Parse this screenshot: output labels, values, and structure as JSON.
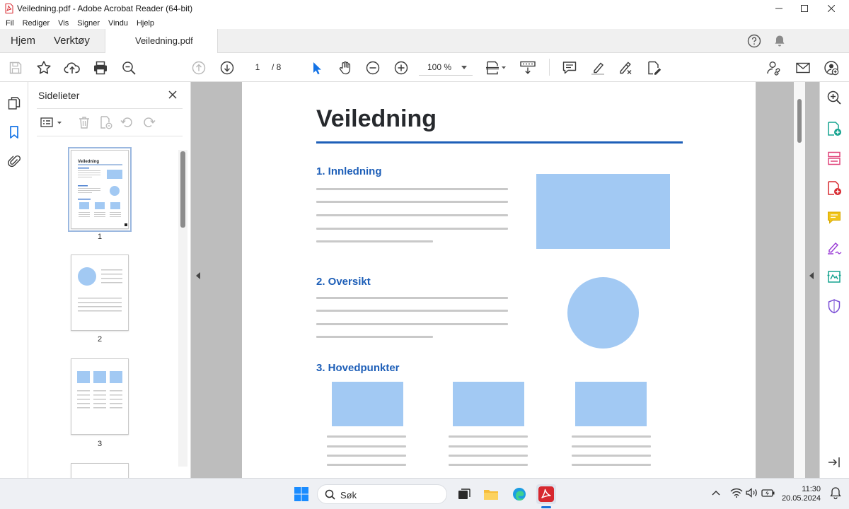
{
  "window": {
    "title": "Veiledning.pdf - Adobe Acrobat Reader (64-bit)",
    "controls": [
      "minimize-icon",
      "maximize-icon",
      "close-icon"
    ]
  },
  "menu": [
    "Fil",
    "Rediger",
    "Vis",
    "Signer",
    "Vindu",
    "Hjelp"
  ],
  "tabs": {
    "home": "Hjem",
    "tools": "Verktøy",
    "document": "Veiledning.pdf"
  },
  "toolbar": {
    "page_current": "1",
    "page_total": "/ 8",
    "zoom": "100 %"
  },
  "sidebar": {
    "title": "Sidelieter",
    "thumbnails": [
      "1",
      "2",
      "3"
    ]
  },
  "document": {
    "title": "Veiledning",
    "sections": [
      "1. Innledning",
      "2. Oversikt",
      "3. Hovedpunkter"
    ]
  },
  "taskbar": {
    "search_label": "Søk",
    "time": "11:30",
    "date": "20.05.2024"
  },
  "colors": {
    "heading_blue": "#1e5fb8",
    "placeholder_blue": "#a2c9f3",
    "acrobat_red": "#d7282f",
    "toolbar_blue": "#1473e6"
  }
}
